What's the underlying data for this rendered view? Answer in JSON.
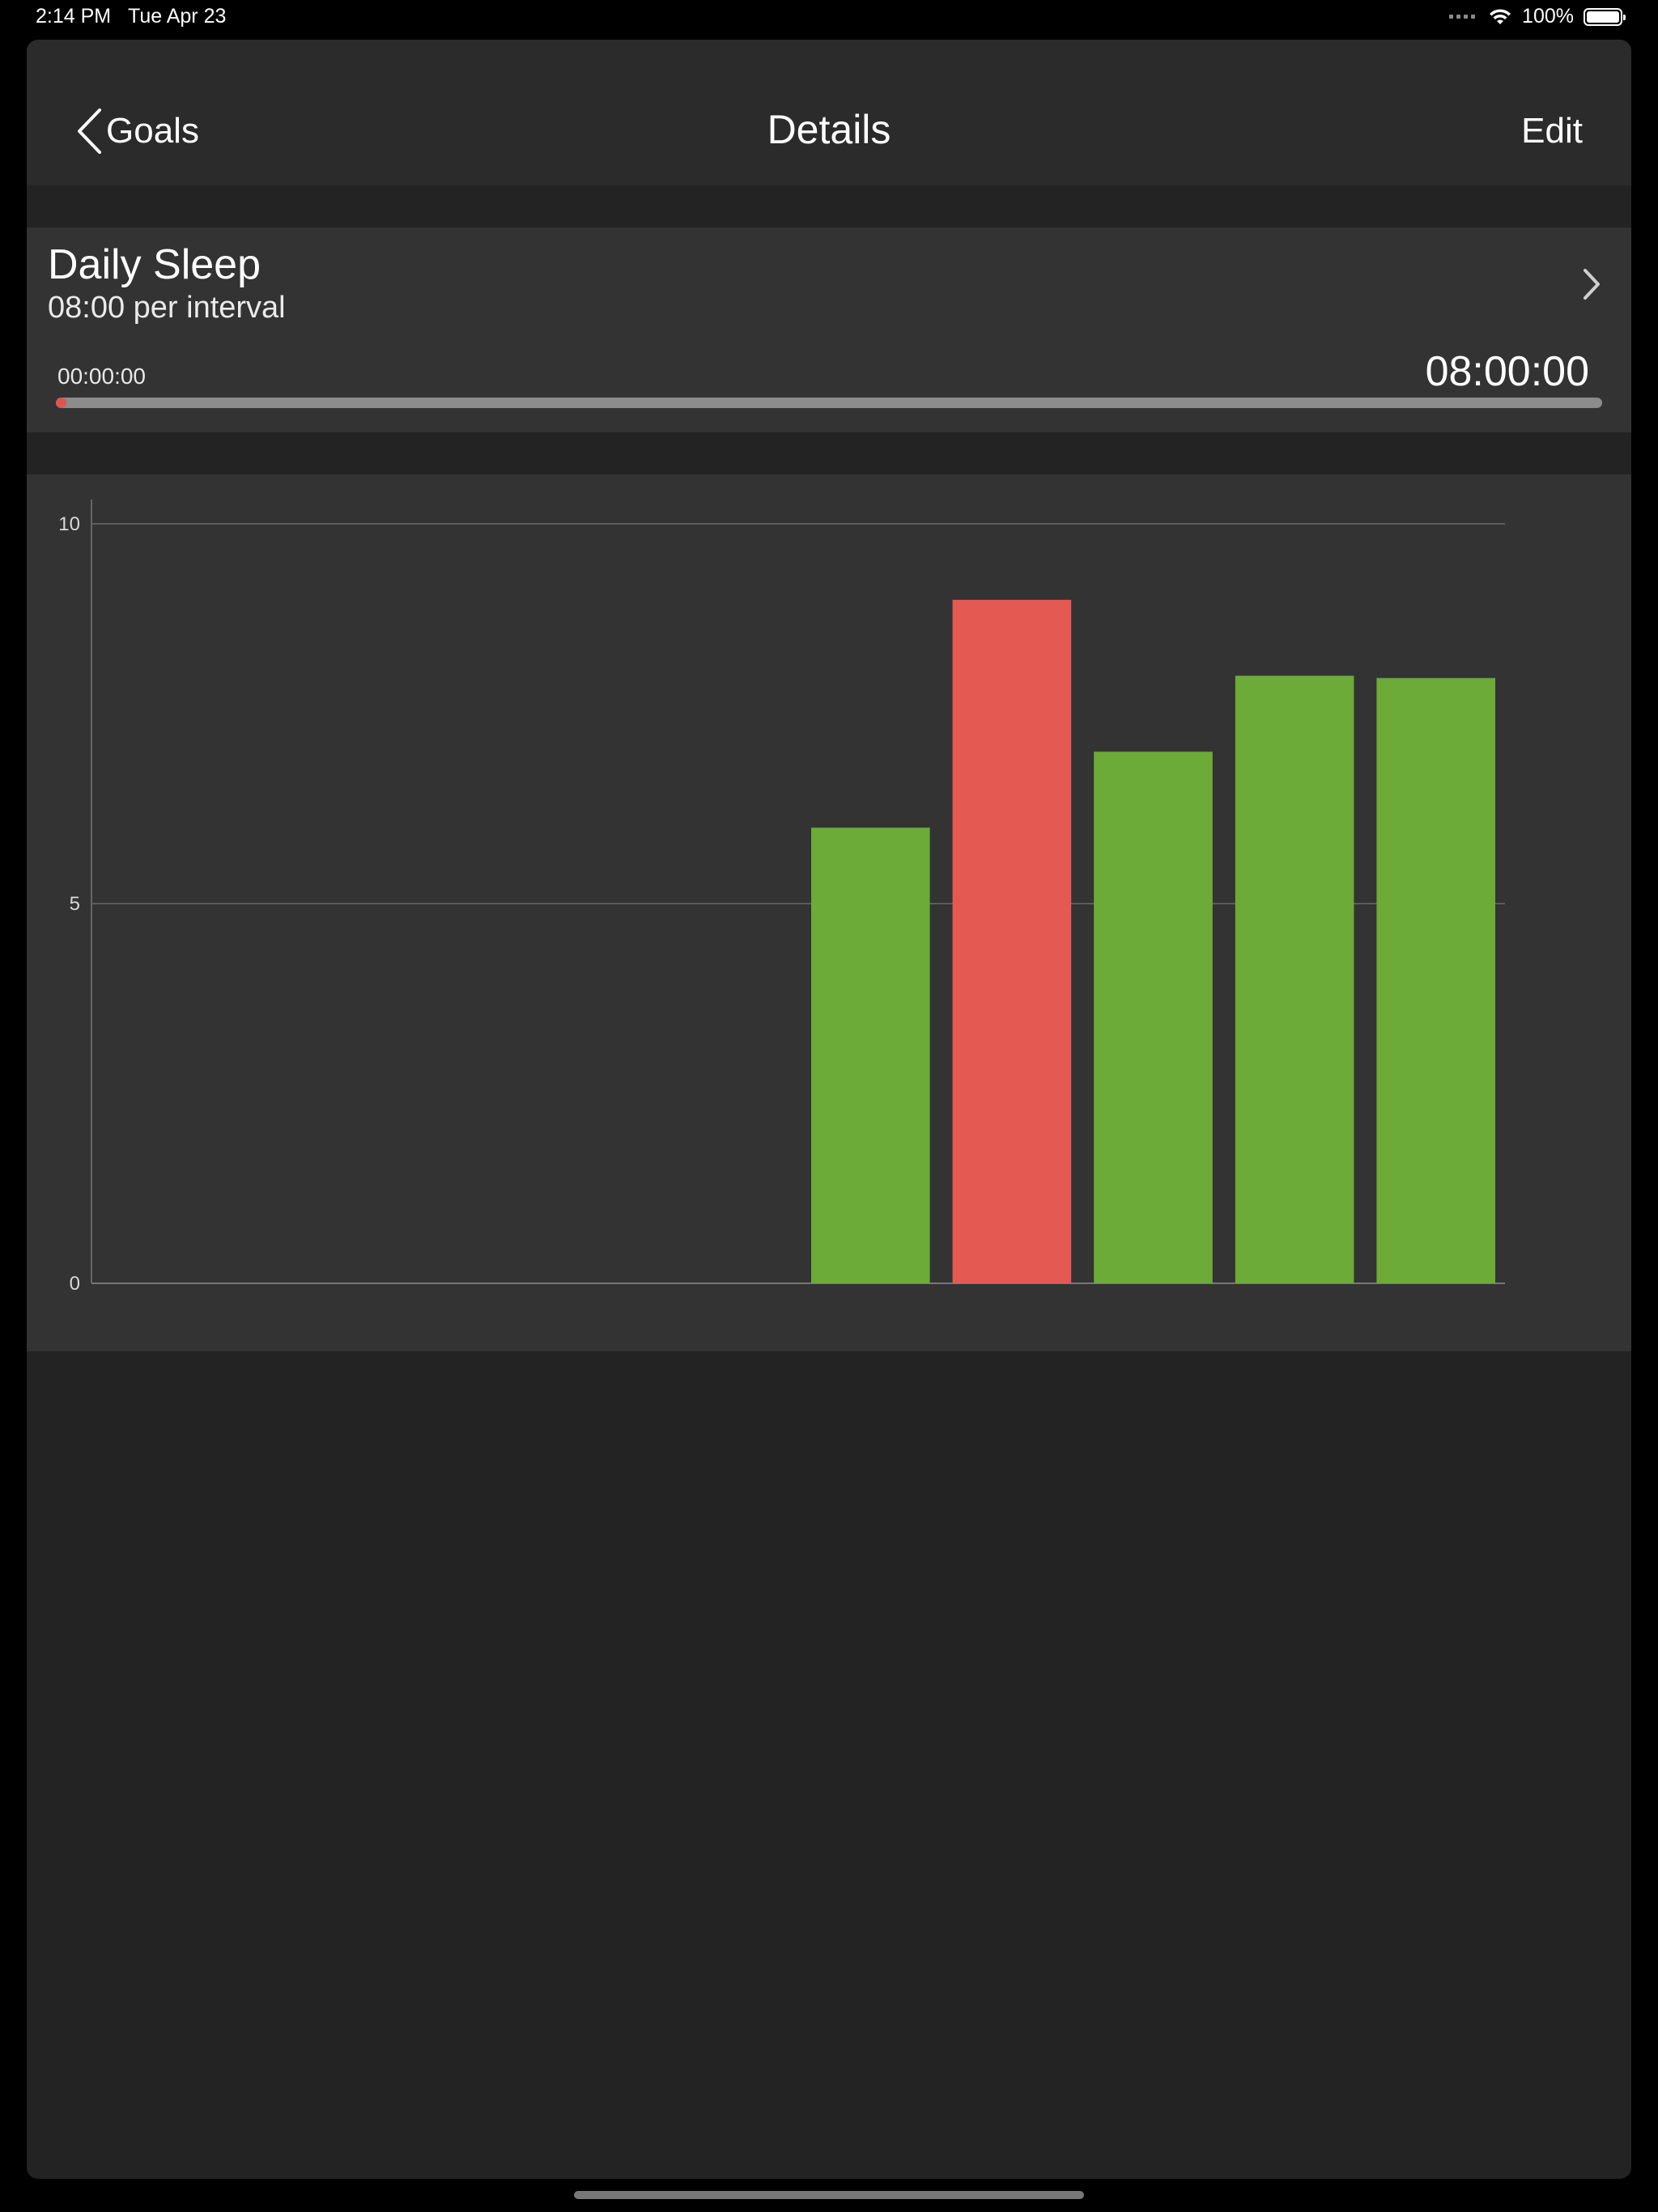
{
  "status": {
    "time": "2:14 PM",
    "date": "Tue Apr 23",
    "battery": "100%"
  },
  "nav": {
    "back_label": "Goals",
    "title": "Details",
    "edit_label": "Edit"
  },
  "goal": {
    "name": "Daily Sleep",
    "subtitle": "08:00 per interval",
    "progress_start": "00:00:00",
    "progress_target": "08:00:00",
    "progress_fraction": 0.0,
    "progress_color": "#e0554f"
  },
  "chart_data": {
    "type": "bar",
    "title": "",
    "xlabel": "",
    "ylabel": "",
    "ylim": [
      0,
      10
    ],
    "yticks": [
      "0",
      "5",
      "10"
    ],
    "grid": true,
    "slots": 10,
    "bars": [
      {
        "slot": 5,
        "value": 6,
        "color": "#6cab37"
      },
      {
        "slot": 6,
        "value": 9,
        "color": "#e45a52"
      },
      {
        "slot": 7,
        "value": 7,
        "color": "#6cab37"
      },
      {
        "slot": 8,
        "value": 8,
        "color": "#6cab37"
      },
      {
        "slot": 9,
        "value": 7.97,
        "color": "#6cab37"
      }
    ]
  }
}
